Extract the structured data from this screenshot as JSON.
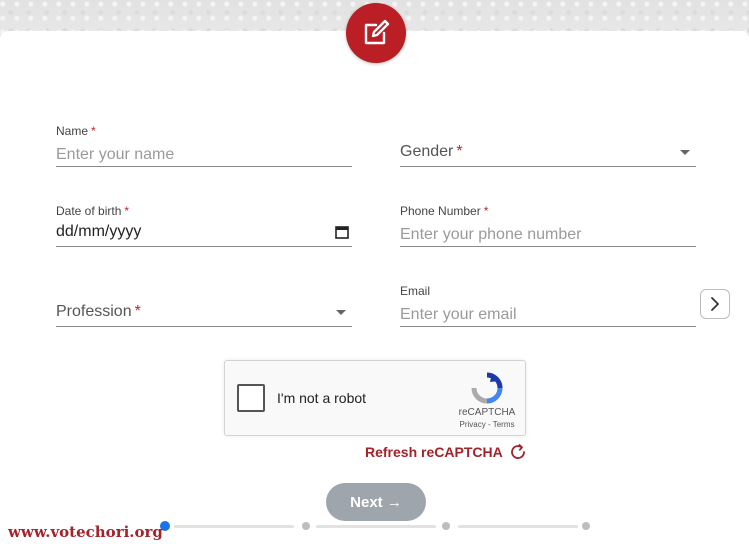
{
  "form": {
    "name": {
      "label": "Name",
      "required_mark": "*",
      "placeholder": "Enter your name"
    },
    "gender": {
      "label": "Gender",
      "required_mark": "*"
    },
    "dob": {
      "label": "Date of birth",
      "required_mark": "*",
      "value": "dd/mm/yyyy"
    },
    "phone": {
      "label": "Phone Number",
      "required_mark": "*",
      "placeholder": "Enter your phone number"
    },
    "profession": {
      "label": "Profession",
      "required_mark": "*"
    },
    "email": {
      "label": "Email",
      "placeholder": "Enter your email"
    }
  },
  "captcha": {
    "checkbox_label": "I'm not a robot",
    "brand": "reCAPTCHA",
    "links": "Privacy - Terms",
    "refresh_label": "Refresh reCAPTCHA"
  },
  "actions": {
    "next_label": "Next →"
  },
  "progress": {
    "current_step": 1,
    "total_steps": 4
  },
  "watermark": "www.votechori.org",
  "colors": {
    "brand_red": "#b91f24",
    "accent_blue": "#1a73e8",
    "button_disabled": "#9ea5ad"
  }
}
